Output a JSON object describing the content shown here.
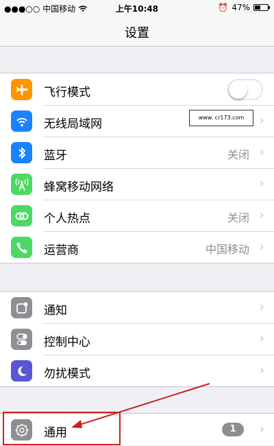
{
  "statusbar": {
    "carrier": "●●●○○ 中国移动",
    "time": "上午10:48",
    "battery": "47%",
    "battery_level": 0.47
  },
  "navbar": {
    "title": "设置"
  },
  "group1": [
    {
      "label": "飞行模式",
      "icon": "airplane-icon",
      "color": "#ff9500"
    },
    {
      "label": "无线局域网",
      "icon": "wifi-icon",
      "color": "#1a82fb"
    },
    {
      "label": "蓝牙",
      "value": "关闭",
      "icon": "bluetooth-icon",
      "color": "#1a82fb"
    },
    {
      "label": "蜂窝移动网络",
      "icon": "cellular-icon",
      "color": "#4cd964"
    },
    {
      "label": "个人热点",
      "value": "关闭",
      "icon": "hotspot-icon",
      "color": "#4cd964"
    },
    {
      "label": "运营商",
      "value": "中国移动",
      "icon": "phone-icon",
      "color": "#4cd964"
    }
  ],
  "watermark": "www. cr173.com",
  "group2": [
    {
      "label": "通知",
      "icon": "notification-icon",
      "color": "#8e8e93"
    },
    {
      "label": "控制中心",
      "icon": "control-center-icon",
      "color": "#8e8e93"
    },
    {
      "label": "勿扰模式",
      "icon": "moon-icon",
      "color": "#5856d6"
    }
  ],
  "group3": [
    {
      "label": "通用",
      "badge": "1",
      "icon": "gear-icon",
      "color": "#8e8e93"
    }
  ],
  "colors": {
    "annotation_red": "#cc1e1e"
  }
}
